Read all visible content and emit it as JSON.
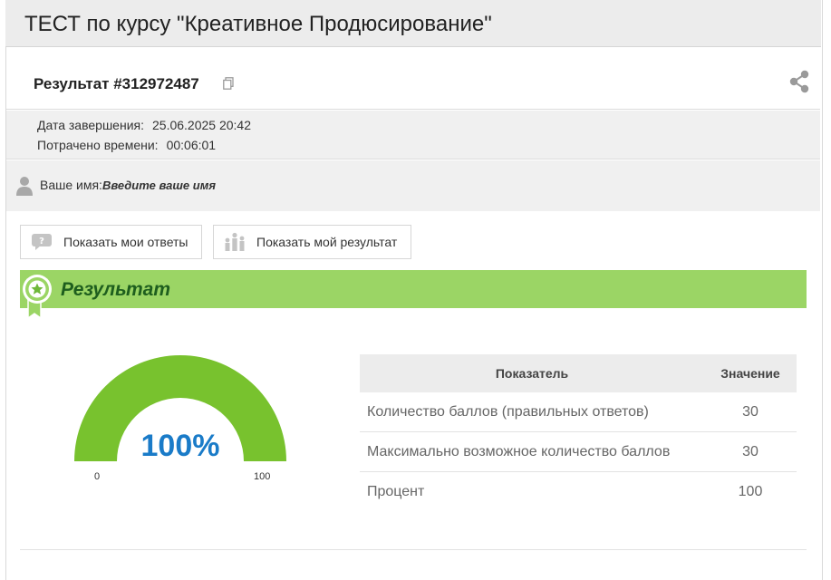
{
  "page": {
    "title": "ТЕСТ по курсу \"Креативное Продюсирование\""
  },
  "result": {
    "title": "Результат #312972487"
  },
  "meta": {
    "completion_label": "Дата завершения:",
    "completion_value": "25.06.2025 20:42",
    "time_label": "Потрачено времени:",
    "time_value": "00:06:01"
  },
  "user": {
    "name_label": "Ваше имя:",
    "name_value": "Введите ваше имя"
  },
  "buttons": {
    "show_answers": "Показать мои ответы",
    "show_result": "Показать мой результат"
  },
  "section": {
    "title": "Результат"
  },
  "gauge": {
    "value": 100,
    "label": "100%",
    "min_label": "0",
    "max_label": "100",
    "color": "#78c22e"
  },
  "table": {
    "headers": [
      "Показатель",
      "Значение"
    ],
    "rows": [
      {
        "name": "Количество баллов (правильных ответов)",
        "value": "30"
      },
      {
        "name": "Максимально возможное количество баллов",
        "value": "30"
      },
      {
        "name": "Процент",
        "value": "100"
      }
    ]
  },
  "icons": {
    "copy": "copy-icon",
    "share": "share-icon",
    "user": "user-icon",
    "answers": "question-bubble-icon",
    "result": "people-chart-icon",
    "badge": "award-badge-icon"
  }
}
